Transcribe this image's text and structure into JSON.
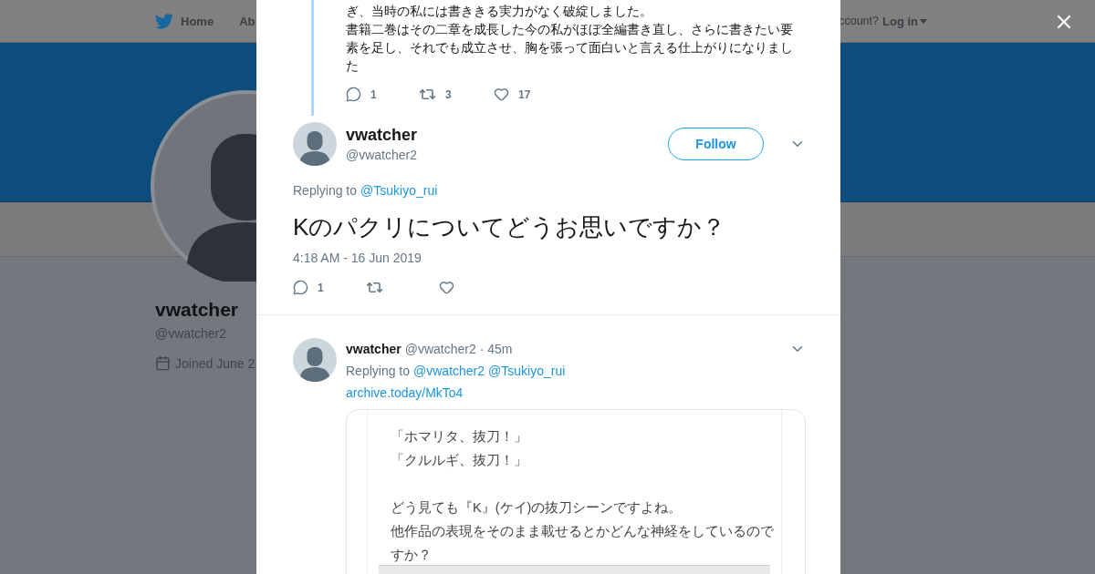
{
  "background": {
    "nav": {
      "home": "Home",
      "about": "Ab",
      "account": "ccount?",
      "login": "Log in"
    },
    "profile": {
      "name": "vwatcher",
      "handle": "@vwatcher2",
      "joined": "Joined June 2"
    }
  },
  "modal": {
    "previous_tweet": {
      "paragraphs": [
        "ぎ、当時の私には書ききる実力がなく破綻しました。",
        "書籍二巻はその二章を成長した今の私がほぼ全編書き直し、さらに書きたい要素を足し、それでも成立させ、胸を張って面白いと言える仕上がりになりました"
      ],
      "replies": "1",
      "retweets": "3",
      "likes": "17"
    },
    "main_tweet": {
      "name": "vwatcher",
      "handle": "@vwatcher2",
      "follow": "Follow",
      "replying_label": "Replying to",
      "replying_to": [
        "@Tsukiyo_rui"
      ],
      "text": "Kのパクリについてどうお思いですか？",
      "time": "4:18 AM - 16 Jun 2019",
      "replies": "1"
    },
    "reply_tweet": {
      "name": "vwatcher",
      "handle": "@vwatcher2",
      "age": "· 45m",
      "replying_label": "Replying to",
      "replying_to": [
        "@vwatcher2",
        "@Tsukiyo_rui"
      ],
      "link": "archive.today/MkTo4",
      "image": {
        "lines": [
          "「ホマリタ、抜刀！」",
          "「クルルギ、抜刀！」"
        ],
        "paragraphs": [
          "どう見ても『K』(ケイ)の抜刀シーンですよね。",
          "他作品の表現をそのまま載せるとかどんな神経をしているのですか？"
        ]
      }
    }
  }
}
